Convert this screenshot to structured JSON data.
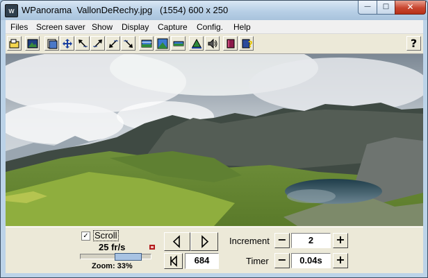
{
  "window": {
    "title": "WPanorama  VallonDeRechy.jpg   (1554) 600 x 250",
    "app_icon": "w",
    "minimize_glyph": "—",
    "maximize_glyph": "□",
    "close_glyph": "✕"
  },
  "menu": {
    "items": [
      "Files",
      "Screen saver",
      "Show",
      "Display",
      "Capture",
      "Config.",
      "Help"
    ]
  },
  "toolbar": {
    "buttons": [
      "open-file-icon",
      "image-icon",
      "fit-window-icon",
      "move-icon",
      "arrow-upleft-icon",
      "arrow-upright-icon",
      "arrow-downleft-icon",
      "arrow-downright-icon",
      "panorama-strip-icon",
      "panorama-full-icon",
      "panorama-thin-icon",
      "horizon-icon",
      "sound-icon",
      "book-icon",
      "help-book-icon"
    ],
    "help_label": "?"
  },
  "controls": {
    "scroll_checked": true,
    "scroll_check_glyph": "✓",
    "scroll_label": "Scroll",
    "fps": "25 fr/s",
    "zoom": "Zoom: 33%",
    "zoom_fraction": 0.33,
    "position_value": "684",
    "increment_label": "Increment",
    "increment_value": "2",
    "timer_label": "Timer",
    "timer_value": "0.04s",
    "minus": "−",
    "plus": "+"
  },
  "colors": {
    "title_bar": "#b7cfe6",
    "close_button": "#c8452f",
    "slider_fill": "#a8c3e3"
  }
}
